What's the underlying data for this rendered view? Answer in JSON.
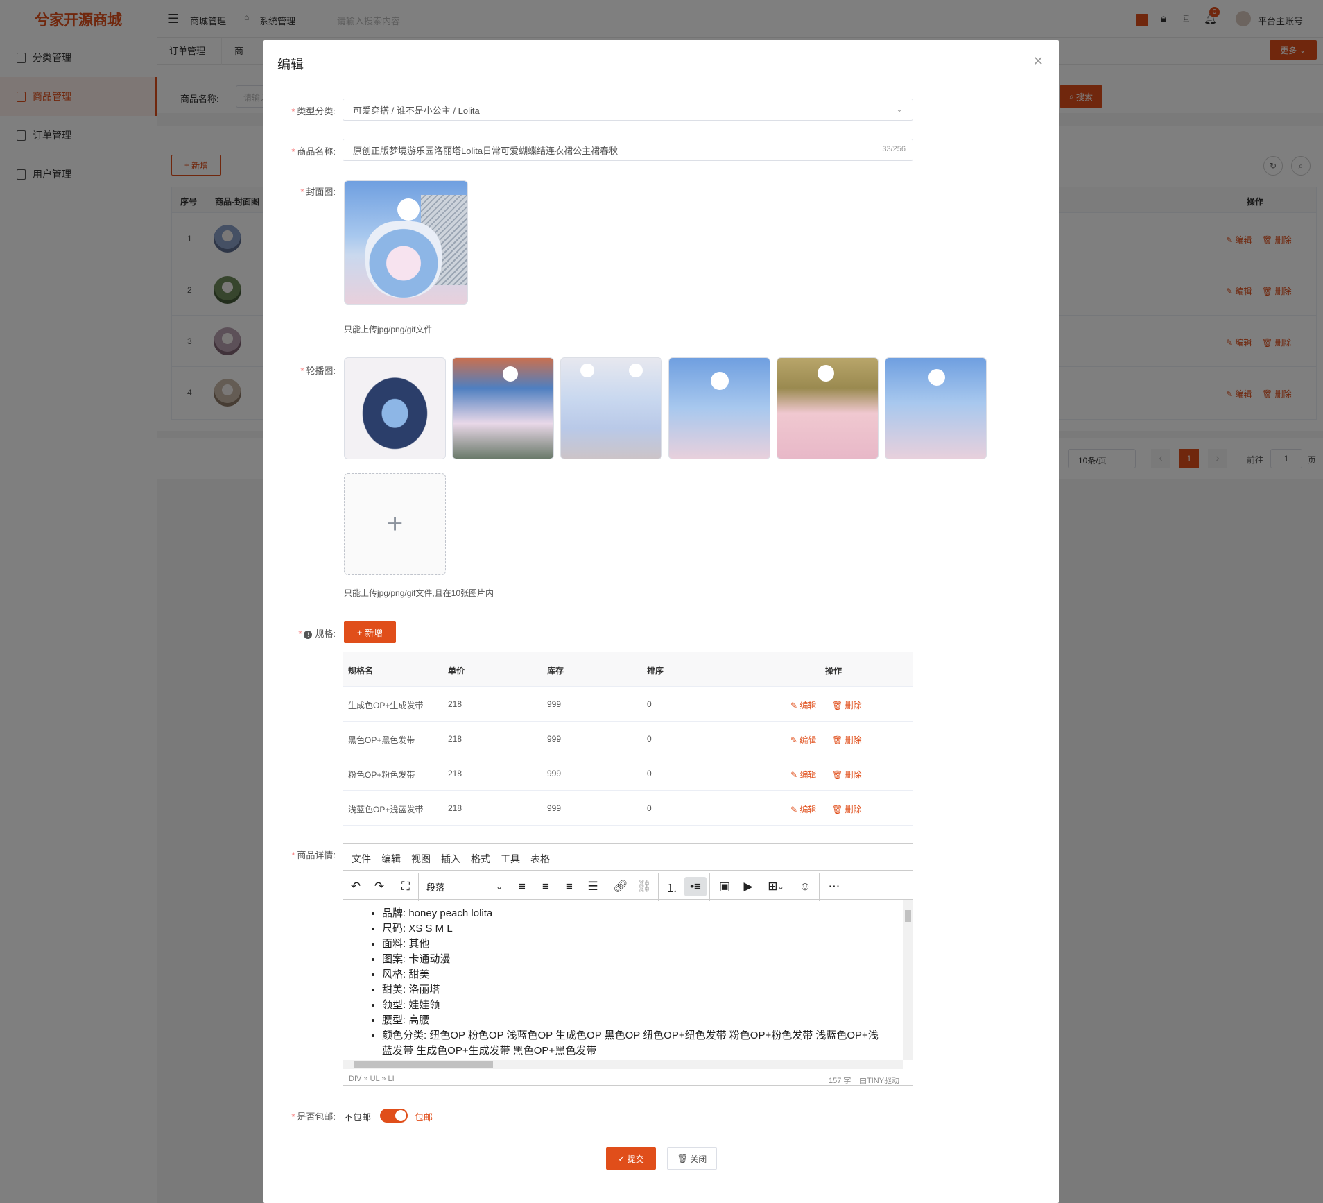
{
  "app": {
    "logo": "兮家开源商城",
    "top_menu": [
      "商城管理",
      "系统管理"
    ],
    "search_placeholder": "请输入搜索内容",
    "notification_count": "0",
    "account": "平台主账号",
    "more_label": "更多"
  },
  "sidebar": {
    "items": [
      {
        "label": "分类管理"
      },
      {
        "label": "商品管理"
      },
      {
        "label": "订单管理"
      },
      {
        "label": "用户管理"
      }
    ]
  },
  "tabs": [
    "订单管理",
    "商品"
  ],
  "filter": {
    "label": "商品名称:",
    "placeholder": "请输入",
    "search_label": "搜索"
  },
  "list": {
    "add_label": "新增",
    "columns": [
      "序号",
      "商品-封面图",
      "操作"
    ],
    "rows": [
      {
        "index": "1"
      },
      {
        "index": "2"
      },
      {
        "index": "3"
      },
      {
        "index": "4"
      }
    ],
    "edit_label": "编辑",
    "delete_label": "删除"
  },
  "pagination": {
    "page_size": "10条/页",
    "current": "1",
    "goto_label": "前往",
    "goto_value": "1",
    "page_unit": "页"
  },
  "dialog": {
    "title": "编辑",
    "category": {
      "label": "类型分类:",
      "value": "可爱穿搭 / 谁不是小公主 / Lolita"
    },
    "name": {
      "label": "商品名称:",
      "value": "原创正版梦境游乐园洛丽塔Lolita日常可爱蝴蝶结连衣裙公主裙春秋",
      "counter": "33/256"
    },
    "cover": {
      "label": "封面图:",
      "hint": "只能上传jpg/png/gif文件"
    },
    "carousel": {
      "label": "轮播图:",
      "hint": "只能上传jpg/png/gif文件,且在10张图片内"
    },
    "spec": {
      "label": "规格:",
      "add_label": "新增",
      "columns": [
        "规格名",
        "单价",
        "库存",
        "排序",
        "操作"
      ],
      "rows": [
        {
          "name": "生成色OP+生成发带",
          "price": "218",
          "stock": "999",
          "sort": "0"
        },
        {
          "name": "黑色OP+黑色发带",
          "price": "218",
          "stock": "999",
          "sort": "0"
        },
        {
          "name": "粉色OP+粉色发带",
          "price": "218",
          "stock": "999",
          "sort": "0"
        },
        {
          "name": "浅蓝色OP+浅蓝发带",
          "price": "218",
          "stock": "999",
          "sort": "0"
        }
      ],
      "edit_label": "编辑",
      "delete_label": "删除"
    },
    "detail": {
      "label": "商品详情:",
      "menus": [
        "文件",
        "编辑",
        "视图",
        "插入",
        "格式",
        "工具",
        "表格"
      ],
      "block_format": "段落",
      "bullets": [
        "品牌: honey peach lolita",
        "尺码: XS S M L",
        "面料: 其他",
        "图案: 卡通动漫",
        "风格: 甜美",
        "甜美: 洛丽塔",
        "领型: 娃娃领",
        "腰型: 高腰",
        "颜色分类: 纽色OP 粉色OP 浅蓝色OP 生成色OP 黑色OP 纽色OP+纽色发带 粉色OP+粉色发带 浅蓝色OP+浅蓝发带 生成色OP+生成发带 黑色OP+黑色发带"
      ],
      "path": "DIV » UL » LI",
      "word_count": "157 字",
      "powered": "由TINY驱动"
    },
    "shipping": {
      "label": "是否包邮:",
      "off_label": "不包邮",
      "on_label": "包邮",
      "on": true
    },
    "submit_label": "提交",
    "close_label": "关闭"
  },
  "colors": {
    "accent": "#e04e1a"
  }
}
